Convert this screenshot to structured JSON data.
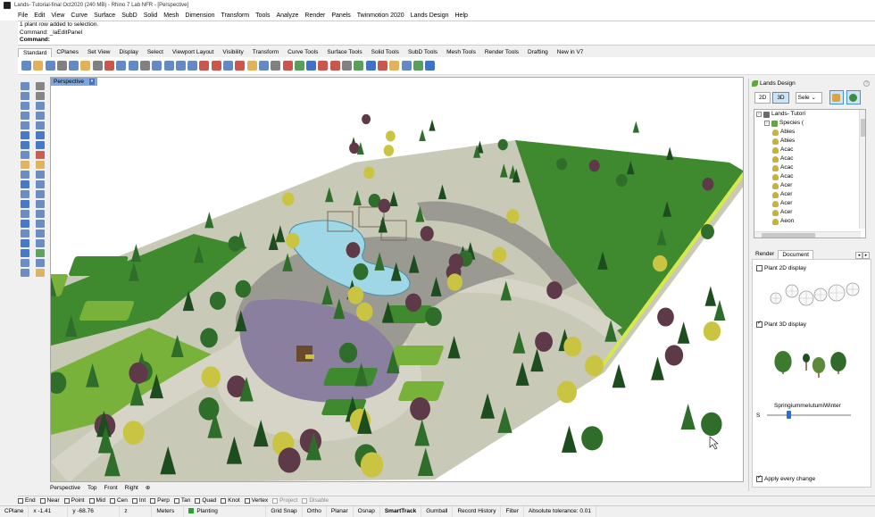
{
  "window": {
    "title": "Lands- Tutorial-final Oct2020 (240 MB) - Rhino 7 Lab NFR - [Perspective]"
  },
  "menu": [
    "File",
    "Edit",
    "View",
    "Curve",
    "Surface",
    "SubD",
    "Solid",
    "Mesh",
    "Dimension",
    "Transform",
    "Tools",
    "Analyze",
    "Render",
    "Panels",
    "Twinmotion 2020",
    "Lands Design",
    "Help"
  ],
  "command_history": {
    "line1": "1 plant row added to selection.",
    "line2": "Command: _laEditPanel",
    "prompt": "Command:"
  },
  "toolbar_tabs": {
    "active": "Standard",
    "items": [
      "Standard",
      "CPlanes",
      "Set View",
      "Display",
      "Select",
      "Viewport Layout",
      "Visibility",
      "Transform",
      "Curve Tools",
      "Surface Tools",
      "Solid Tools",
      "SubD Tools",
      "Mesh Tools",
      "Render Tools",
      "Drafting",
      "New in V7"
    ]
  },
  "toolbar_icon_colors": [
    "#4a74b9",
    "#d9a441",
    "#4a74b9",
    "#6b6b6b",
    "#4a74b9",
    "#d9a441",
    "#6b6b6b",
    "#c0392b",
    "#4a74b9",
    "#4a74b9",
    "#6b6b6b",
    "#4a74b9",
    "#4a74b9",
    "#4a74b9",
    "#4a74b9",
    "#c0392b",
    "#c0392b",
    "#4a74b9",
    "#c0392b",
    "#d9a441",
    "#4a74b9",
    "#6b6b6b",
    "#c0392b",
    "#3c8e3c",
    "#1e5bbd",
    "#c0392b",
    "#c0392b",
    "#6b6b6b",
    "#3c8e3c",
    "#1e5bbd",
    "#c0392b",
    "#d9a441",
    "#4a74b9",
    "#3c8e3c",
    "#1e5bbd"
  ],
  "left_tool_colors": [
    "#4a74b9",
    "#6b6b6b",
    "#4a74b9",
    "#6b6b6b",
    "#4a74b9",
    "#4a74b9",
    "#4a74b9",
    "#4a74b9",
    "#4a74b9",
    "#4a74b9",
    "#1e5bbd",
    "#1e5bbd",
    "#1e5bbd",
    "#1e5bbd",
    "#4a74b9",
    "#c0392b",
    "#d9a441",
    "#d9a441",
    "#4a74b9",
    "#4a74b9",
    "#1e5bbd",
    "#4a74b9",
    "#4a74b9",
    "#4a74b9",
    "#1e5bbd",
    "#4a74b9",
    "#4a74b9",
    "#4a74b9",
    "#1e5bbd",
    "#4a74b9",
    "#4a74b9",
    "#4a74b9",
    "#1e5bbd",
    "#4a74b9",
    "#1e5bbd",
    "#3c8e3c",
    "#4a74b9",
    "#4a74b9",
    "#4a74b9",
    "#d9a441"
  ],
  "viewport": {
    "label": "Perspective",
    "colors": {
      "ground": "#c9c9b8",
      "grass": "#3f8a2e",
      "grass_light": "#78b23a",
      "road": "#9a9a93",
      "path": "#d5d4c6",
      "water": "#9fd7e6",
      "play": "#8b7fa0",
      "tree_dark": "#1d4d1f",
      "tree_mid": "#2f6e2a",
      "tree_purple": "#5e3a48",
      "tree_yellow": "#c9c542",
      "edge": "#d7e84a"
    }
  },
  "view_tabs": [
    "Perspective",
    "Top",
    "Front",
    "Right",
    "⊕"
  ],
  "osnaps": [
    {
      "label": "End",
      "checked": false,
      "disabled": false
    },
    {
      "label": "Near",
      "checked": false,
      "disabled": false
    },
    {
      "label": "Point",
      "checked": false,
      "disabled": false
    },
    {
      "label": "Mid",
      "checked": false,
      "disabled": false
    },
    {
      "label": "Cen",
      "checked": false,
      "disabled": false
    },
    {
      "label": "Int",
      "checked": false,
      "disabled": false
    },
    {
      "label": "Perp",
      "checked": false,
      "disabled": false
    },
    {
      "label": "Tan",
      "checked": false,
      "disabled": false
    },
    {
      "label": "Quad",
      "checked": false,
      "disabled": false
    },
    {
      "label": "Knot",
      "checked": false,
      "disabled": false
    },
    {
      "label": "Vertex",
      "checked": false,
      "disabled": false
    },
    {
      "label": "Project",
      "checked": false,
      "disabled": true
    },
    {
      "label": "Disable",
      "checked": false,
      "disabled": true
    }
  ],
  "status": {
    "cplane": "CPlane",
    "x": "x -1.41",
    "y": "y -68.76",
    "z": "z",
    "units": "Meters",
    "layer": "Planting",
    "layer_color": "#2aa12a",
    "grid_snap": "Grid Snap",
    "ortho": "Ortho",
    "planar": "Planar",
    "osnap": "Osnap",
    "smarttrack": "SmartTrack",
    "gumball": "Gumball",
    "record_history": "Record History",
    "filter": "Filter",
    "tolerance": "Absolute tolerance: 0.01"
  },
  "panel": {
    "title": "Lands Design",
    "btn_2d": "2D",
    "btn_3d": "3D",
    "select": "Sele",
    "tree": [
      {
        "label": "Lands- Tutori",
        "level": 0,
        "expander": "-",
        "kind": "doc"
      },
      {
        "label": "Species (",
        "level": 1,
        "expander": "-",
        "kind": "species"
      },
      {
        "label": "Abies",
        "level": 2,
        "kind": "plant"
      },
      {
        "label": "Abies",
        "level": 2,
        "kind": "plant"
      },
      {
        "label": "Acac",
        "level": 2,
        "kind": "plant"
      },
      {
        "label": "Acac",
        "level": 2,
        "kind": "plant"
      },
      {
        "label": "Acac",
        "level": 2,
        "kind": "plant"
      },
      {
        "label": "Acac",
        "level": 2,
        "kind": "plant"
      },
      {
        "label": "Acer",
        "level": 2,
        "kind": "plant"
      },
      {
        "label": "Acer",
        "level": 2,
        "kind": "plant"
      },
      {
        "label": "Acer",
        "level": 2,
        "kind": "plant"
      },
      {
        "label": "Acer",
        "level": 2,
        "kind": "plant"
      },
      {
        "label": "Aeon",
        "level": 2,
        "kind": "plant"
      }
    ],
    "tabs": [
      "Render",
      "Document"
    ],
    "active_tab": "Document",
    "plant2d_label": "Plant 2D display",
    "plant2d_checked": false,
    "plant3d_label": "Plant 3D display",
    "plant3d_checked": true,
    "season_label": "SpringiummeIutumiWinter",
    "season_prefix": "S",
    "season_value": 0.25,
    "apply_label": "Apply every change",
    "apply_checked": true
  }
}
